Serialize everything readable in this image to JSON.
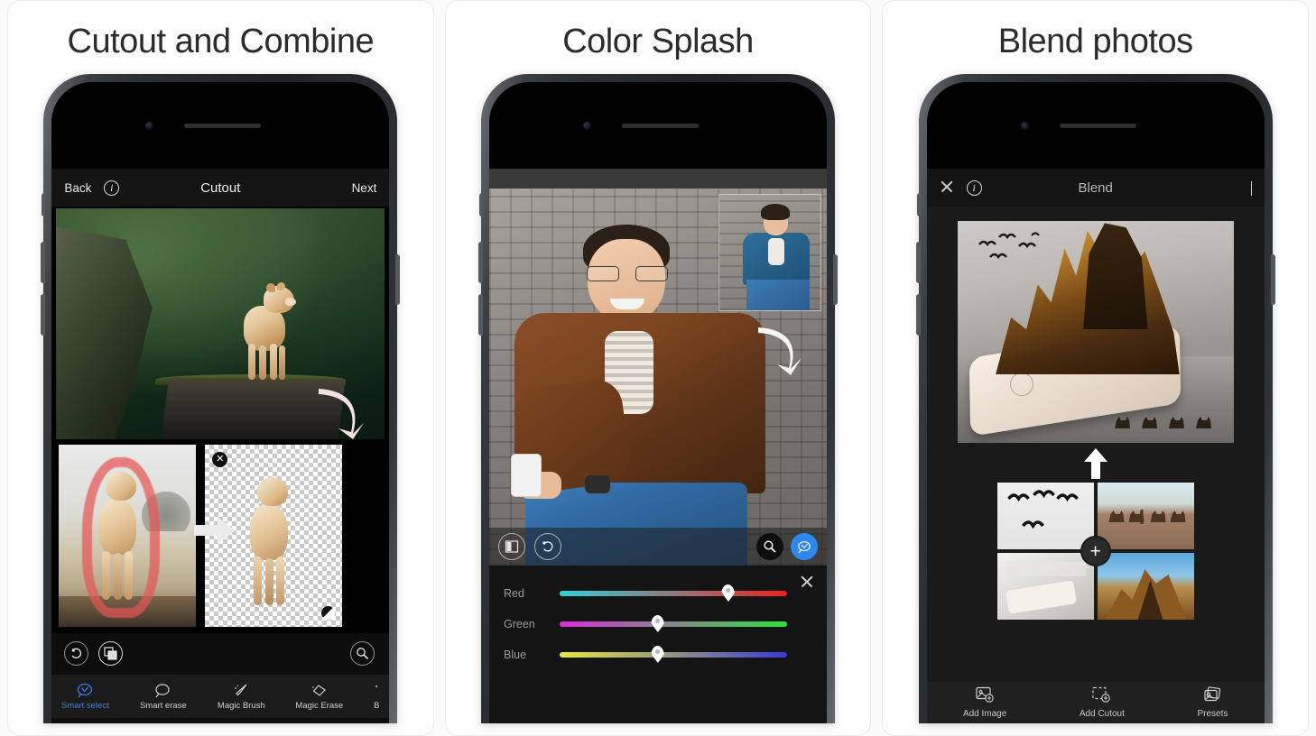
{
  "panels": [
    {
      "title": "Cutout and Combine",
      "nav": {
        "back_label": "Back",
        "info_icon": "info-circle-icon",
        "title": "Cutout",
        "next_label": "Next"
      },
      "canvas": {
        "hero_description": "lioness standing on mossy cliff with green mountain valley",
        "arrow_icon": "curved-arrow-icon"
      },
      "thumbnails": {
        "source_description": "lioness with red selection outline on savanna",
        "result_description": "cutout lioness on transparent checkerboard",
        "transform_arrow_icon": "arrow-right-icon",
        "close_badge_icon": "close-badge-icon",
        "handle_badge_icon": "rotate-handle-icon"
      },
      "tools": [
        {
          "icon": "undo-icon",
          "name": "undo-button"
        },
        {
          "icon": "layers-transparency-icon",
          "name": "transparency-button"
        },
        {
          "icon": "zoom-magnifier-icon",
          "name": "zoom-button"
        }
      ],
      "tabs": [
        {
          "label": "Smart select",
          "icon": "smart-select-icon",
          "active": true
        },
        {
          "label": "Smart erase",
          "icon": "smart-erase-icon",
          "active": false
        },
        {
          "label": "Magic Brush",
          "icon": "magic-brush-icon",
          "active": false
        },
        {
          "label": "Magic Erase",
          "icon": "magic-erase-icon",
          "active": false
        },
        {
          "label": "B",
          "icon": "more-tools-icon",
          "active": false
        }
      ]
    },
    {
      "title": "Color Splash",
      "canvas": {
        "main_description": "smiling man with glasses in brown leather jacket and blue jeans against stone wall",
        "inset_description": "original photo thumbnail with blue jacket",
        "arrow_icon": "curved-arrow-icon"
      },
      "controls": [
        {
          "icon": "split-compare-icon",
          "name": "compare-button"
        },
        {
          "icon": "undo-icon",
          "name": "undo-button"
        },
        {
          "icon": "zoom-magnifier-icon",
          "name": "zoom-button"
        },
        {
          "icon": "smart-select-icon",
          "name": "smart-select-button",
          "accent": "#2f88f0"
        }
      ],
      "sliders": [
        {
          "label": "Red",
          "value": 74,
          "from": "#2fd0d8",
          "to": "#f02020"
        },
        {
          "label": "Green",
          "value": 43,
          "from": "#d82fd8",
          "to": "#2fe03a"
        },
        {
          "label": "Blue",
          "value": 43,
          "from": "#e8e83a",
          "to": "#3a3ad8"
        }
      ],
      "close_icon": "close-icon"
    },
    {
      "title": "Blend photos",
      "nav": {
        "close_icon": "close-icon",
        "info_icon": "info-circle-icon",
        "title": "Blend",
        "confirm_icon": "check-icon"
      },
      "canvas": {
        "blend_description": "rocky mountain emerging from an iPhone on a desk with birds and camel caravan"
      },
      "grid": {
        "cells": [
          {
            "description": "flying birds silhouettes on pale sky",
            "name": "layer-thumb-birds"
          },
          {
            "description": "camel caravan in desert",
            "name": "layer-thumb-camels"
          },
          {
            "description": "iPhone lying on a table",
            "name": "layer-thumb-phone"
          },
          {
            "description": "rocky mountain against blue sky",
            "name": "layer-thumb-mountain"
          }
        ],
        "add_icon": "plus-icon",
        "up_arrow_icon": "arrow-up-icon"
      },
      "tabs": [
        {
          "label": "Add Image",
          "icon": "add-image-icon"
        },
        {
          "label": "Add Cutout",
          "icon": "add-cutout-icon"
        },
        {
          "label": "Presets",
          "icon": "presets-icon"
        }
      ]
    }
  ]
}
